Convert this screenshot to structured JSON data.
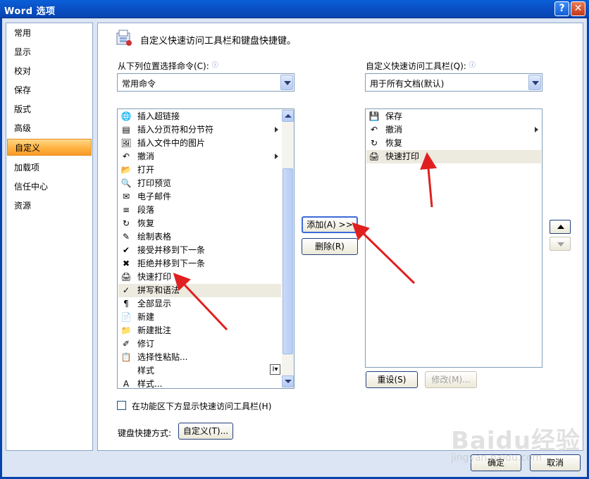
{
  "window": {
    "title": "Word 选项",
    "help_label": "?",
    "close_label": "✕"
  },
  "nav": {
    "items": [
      {
        "label": "常用"
      },
      {
        "label": "显示"
      },
      {
        "label": "校对"
      },
      {
        "label": "保存"
      },
      {
        "label": "版式"
      },
      {
        "label": "高级"
      },
      {
        "label": "自定义"
      },
      {
        "label": "加载项"
      },
      {
        "label": "信任中心"
      },
      {
        "label": "资源"
      }
    ],
    "active": "自定义"
  },
  "header": {
    "text": "自定义快速访问工具栏和键盘快捷键。"
  },
  "left_panel": {
    "label": "从下列位置选择命令(C):",
    "combo_value": "常用命令",
    "commands": [
      {
        "label": "插入超链接",
        "icon": "🌐",
        "submenu": false
      },
      {
        "label": "插入分页符和分节符",
        "icon": "▤",
        "submenu": true
      },
      {
        "label": "插入文件中的图片",
        "icon": "🖼",
        "submenu": false
      },
      {
        "label": "撤消",
        "icon": "↶",
        "submenu": true
      },
      {
        "label": "打开",
        "icon": "📂",
        "submenu": false
      },
      {
        "label": "打印预览",
        "icon": "🔍",
        "submenu": false
      },
      {
        "label": "电子邮件",
        "icon": "✉",
        "submenu": false
      },
      {
        "label": "段落",
        "icon": "≡",
        "submenu": false
      },
      {
        "label": "恢复",
        "icon": "↻",
        "submenu": false
      },
      {
        "label": "绘制表格",
        "icon": "✎",
        "submenu": false
      },
      {
        "label": "接受并移到下一条",
        "icon": "✔",
        "submenu": false
      },
      {
        "label": "拒绝并移到下一条",
        "icon": "✖",
        "submenu": false
      },
      {
        "label": "快速打印",
        "icon": "🖨",
        "submenu": false
      },
      {
        "label": "拼写和语法",
        "icon": "✓",
        "submenu": false
      },
      {
        "label": "全部显示",
        "icon": "¶",
        "submenu": false
      },
      {
        "label": "新建",
        "icon": "📄",
        "submenu": false
      },
      {
        "label": "新建批注",
        "icon": "📁",
        "submenu": false
      },
      {
        "label": "修订",
        "icon": "✐",
        "submenu": false
      },
      {
        "label": "选择性粘贴...",
        "icon": "📋",
        "submenu": false
      },
      {
        "label": "样式",
        "icon": "",
        "submenu": false
      },
      {
        "label": "样式...",
        "icon": "A",
        "submenu": false
      }
    ],
    "selected_index": 13
  },
  "right_panel": {
    "label": "自定义快速访问工具栏(Q):",
    "combo_value": "用于所有文档(默认)",
    "commands": [
      {
        "label": "保存",
        "icon": "💾",
        "submenu": false
      },
      {
        "label": "撤消",
        "icon": "↶",
        "submenu": true
      },
      {
        "label": "恢复",
        "icon": "↻",
        "submenu": false
      },
      {
        "label": "快速打印",
        "icon": "🖨",
        "submenu": false
      }
    ],
    "selected_index": 3
  },
  "buttons": {
    "add": "添加(A) >>",
    "remove": "删除(R)",
    "reset": "重设(S)",
    "modify": "修改(M)...",
    "customize": "自定义(T)...",
    "ok": "确定",
    "cancel": "取消"
  },
  "checkbox": {
    "label": "在功能区下方显示快速访问工具栏(H)",
    "checked": false
  },
  "keyboard": {
    "label": "键盘快捷方式:"
  },
  "watermark": {
    "main": "Baidu经验",
    "sub": "jingyan.baidu.com"
  },
  "style_dropdown_glyph": "I▾"
}
